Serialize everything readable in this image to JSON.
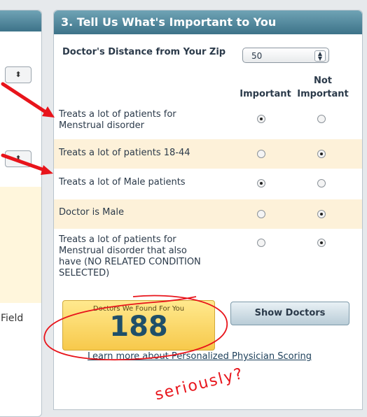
{
  "left_panel": {
    "field_label": "Field"
  },
  "section": {
    "title": "3. Tell Us What's Important to You",
    "distance_label": "Doctor's Distance from Your Zip",
    "distance_value": "50",
    "col_important": "Important",
    "col_not_important_line1": "Not",
    "col_not_important_line2": "Important"
  },
  "criteria": [
    {
      "line1": "Treats a lot of patients for",
      "line2": "Menstrual disorder",
      "line3": "",
      "line4": "",
      "important": true
    },
    {
      "line1": "Treats a lot of patients 18-44",
      "line2": "",
      "line3": "",
      "line4": "",
      "important": false
    },
    {
      "line1": "Treats a lot of Male patients",
      "line2": "",
      "line3": "",
      "line4": "",
      "important": true
    },
    {
      "line1": "Doctor is Male",
      "line2": "",
      "line3": "",
      "line4": "",
      "important": false
    },
    {
      "line1": "Treats a lot of patients for",
      "line2": "Menstrual disorder that also",
      "line3": "have (NO RELATED CONDITION",
      "line4": "SELECTED)",
      "important": false
    }
  ],
  "results": {
    "found_label": "Doctors We Found For You",
    "found_count": "188",
    "show_button": "Show Doctors",
    "learn_link": "Learn more about Personalized Physician Scoring"
  },
  "annotation": {
    "handwritten": "seriously?"
  },
  "colors": {
    "header": "#3d7389",
    "arrow": "#e8141b",
    "scribble": "#e8141b",
    "cream": "#fdf1d9"
  }
}
